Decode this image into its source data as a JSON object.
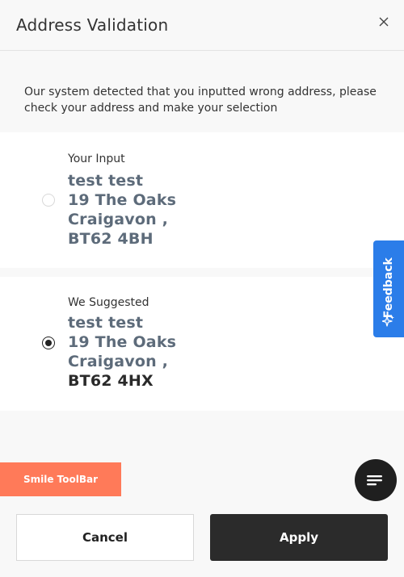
{
  "modal": {
    "title": "Address Validation",
    "close_icon": "close-icon",
    "intro": "Our system detected that you inputted wrong address, please check your address and make your selection"
  },
  "options": [
    {
      "label": "Your Input",
      "selected": false,
      "lines": [
        "test test",
        "19 The Oaks",
        "Craigavon ,",
        "BT62 4BH"
      ]
    },
    {
      "label": "We Suggested",
      "selected": true,
      "lines": [
        "test test",
        "19 The Oaks",
        "Craigavon ,",
        "BT62 4HX"
      ],
      "highlight_line": 3
    }
  ],
  "feedback": {
    "label": "Feedback",
    "icon": "sparkle-icon",
    "color": "#2b7de9"
  },
  "smile_toolbar": {
    "label": "Smile ToolBar",
    "color": "#ff7a59"
  },
  "chat": {
    "icon": "chat-menu-icon"
  },
  "footer": {
    "cancel_label": "Cancel",
    "apply_label": "Apply"
  },
  "colors": {
    "address_text": "#5d6b7a",
    "highlight_text": "#2a2a2a",
    "dark": "#2b2b2b"
  }
}
